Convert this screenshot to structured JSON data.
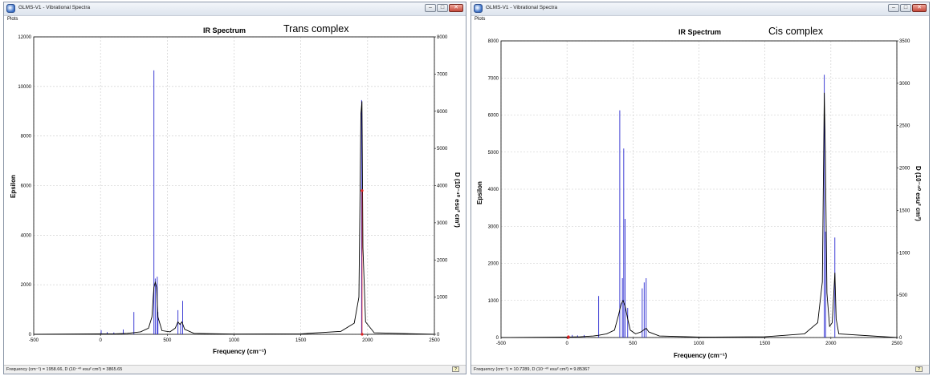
{
  "windows": [
    {
      "id": "trans",
      "title": "GLMS-V1 - Vibrational Spectra",
      "menu": "Plots",
      "status": "Frequency (cm⁻¹) = 1958.66, D (10⁻⁴⁰ esu² cm²) = 3865.65",
      "chart_title": "IR Spectrum",
      "annotation": "Trans complex"
    },
    {
      "id": "cis",
      "title": "GLMS-V1 - Vibrational Spectra",
      "menu": "Plots",
      "status": "Frequency (cm⁻¹) = 10.7289, D (10⁻⁴⁰ esu² cm²) = 9.85367",
      "chart_title": "IR Spectrum",
      "annotation": "Cis complex"
    }
  ],
  "window_buttons": {
    "minimize": "–",
    "maximize": "□",
    "close": "✕"
  },
  "status_button": "?",
  "colors": {
    "curve": "#000000",
    "stick": "#2a2ad0",
    "grid": "#c8c8c8",
    "marker": "#e02020"
  },
  "chart_data": [
    {
      "type": "line",
      "title": "IR Spectrum",
      "xlabel": "Frequency (cm⁻¹)",
      "ylabel": "Epsilon",
      "y2label": "D (10⁻⁴⁰ esu² cm²)",
      "xlim": [
        -500,
        2500
      ],
      "ylim": [
        0,
        12000
      ],
      "y2lim": [
        0,
        8000
      ],
      "xticks": [
        -500,
        0,
        500,
        1000,
        1500,
        2000,
        2500
      ],
      "yticks": [
        0,
        2000,
        4000,
        6000,
        8000,
        10000,
        12000
      ],
      "y2ticks": [
        0,
        1000,
        2000,
        3000,
        4000,
        5000,
        6000,
        7000,
        8000
      ],
      "grid": true,
      "sticks_D": [
        [
          5,
          110
        ],
        [
          50,
          60
        ],
        [
          100,
          50
        ],
        [
          170,
          130
        ],
        [
          250,
          600
        ],
        [
          400,
          7100
        ],
        [
          410,
          1500
        ],
        [
          425,
          1550
        ],
        [
          430,
          600
        ],
        [
          580,
          650
        ],
        [
          600,
          300
        ],
        [
          615,
          900
        ],
        [
          1955,
          6300
        ]
      ],
      "epsilon_curve": [
        [
          -500,
          0
        ],
        [
          0,
          15
        ],
        [
          100,
          20
        ],
        [
          200,
          40
        ],
        [
          240,
          60
        ],
        [
          300,
          100
        ],
        [
          360,
          250
        ],
        [
          385,
          700
        ],
        [
          400,
          1900
        ],
        [
          410,
          2100
        ],
        [
          420,
          1900
        ],
        [
          430,
          700
        ],
        [
          460,
          150
        ],
        [
          520,
          100
        ],
        [
          560,
          250
        ],
        [
          580,
          500
        ],
        [
          595,
          400
        ],
        [
          610,
          500
        ],
        [
          630,
          200
        ],
        [
          700,
          40
        ],
        [
          1000,
          10
        ],
        [
          1500,
          20
        ],
        [
          1800,
          120
        ],
        [
          1900,
          450
        ],
        [
          1935,
          1500
        ],
        [
          1950,
          8900
        ],
        [
          1958,
          9400
        ],
        [
          1965,
          3500
        ],
        [
          1985,
          500
        ],
        [
          2050,
          60
        ],
        [
          2500,
          0
        ]
      ],
      "marker": [
        1958.66,
        3865.65
      ]
    },
    {
      "type": "line",
      "title": "IR Spectrum",
      "xlabel": "Frequency (cm⁻¹)",
      "ylabel": "Epsilon",
      "y2label": "D (10⁻⁴⁰ esu² cm²)",
      "xlim": [
        -500,
        2500
      ],
      "ylim": [
        0,
        8000
      ],
      "y2lim": [
        0,
        3500
      ],
      "xticks": [
        -500,
        0,
        500,
        1000,
        1500,
        2000,
        2500
      ],
      "yticks": [
        0,
        1000,
        2000,
        3000,
        4000,
        5000,
        6000,
        7000,
        8000
      ],
      "y2ticks": [
        0,
        500,
        1000,
        1500,
        2000,
        2500,
        3000,
        3500
      ],
      "grid": true,
      "sticks_D": [
        [
          40,
          30
        ],
        [
          80,
          25
        ],
        [
          130,
          30
        ],
        [
          240,
          490
        ],
        [
          400,
          2680
        ],
        [
          420,
          700
        ],
        [
          430,
          2230
        ],
        [
          440,
          1400
        ],
        [
          460,
          350
        ],
        [
          570,
          580
        ],
        [
          585,
          650
        ],
        [
          600,
          700
        ],
        [
          1950,
          3100
        ],
        [
          1960,
          1250
        ],
        [
          2030,
          1180
        ]
      ],
      "epsilon_curve": [
        [
          -500,
          0
        ],
        [
          0,
          10
        ],
        [
          100,
          20
        ],
        [
          200,
          40
        ],
        [
          240,
          60
        ],
        [
          300,
          100
        ],
        [
          360,
          200
        ],
        [
          390,
          600
        ],
        [
          410,
          900
        ],
        [
          425,
          1000
        ],
        [
          440,
          850
        ],
        [
          460,
          500
        ],
        [
          480,
          200
        ],
        [
          520,
          100
        ],
        [
          560,
          150
        ],
        [
          580,
          200
        ],
        [
          600,
          250
        ],
        [
          620,
          150
        ],
        [
          700,
          40
        ],
        [
          1000,
          10
        ],
        [
          1500,
          20
        ],
        [
          1800,
          100
        ],
        [
          1900,
          400
        ],
        [
          1935,
          1500
        ],
        [
          1950,
          6600
        ],
        [
          1958,
          5000
        ],
        [
          1970,
          1200
        ],
        [
          1990,
          300
        ],
        [
          2010,
          400
        ],
        [
          2030,
          1750
        ],
        [
          2040,
          500
        ],
        [
          2060,
          100
        ],
        [
          2500,
          0
        ]
      ],
      "marker": [
        10.7289,
        9.85367
      ]
    }
  ]
}
